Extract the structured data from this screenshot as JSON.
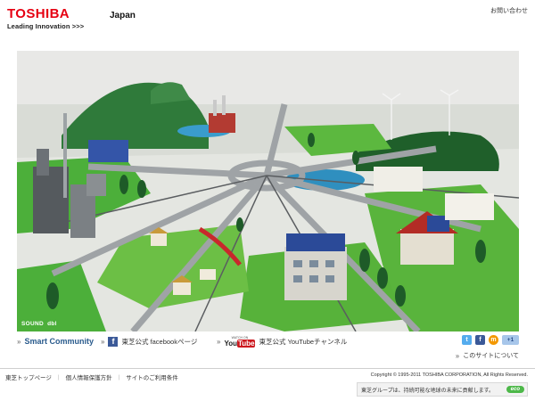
{
  "header": {
    "logo_name": "TOSHIBA",
    "logo_tagline": "Leading Innovation",
    "logo_arrows": ">>>",
    "country": "Japan",
    "contact_link": "お問い合わせ"
  },
  "stage": {
    "sound_label": "SOUND",
    "sound_indicator": "dbl"
  },
  "linkbar": {
    "smart_community": "Smart Community",
    "facebook_icon_letter": "f",
    "facebook_label": "東芝公式 facebookページ",
    "youtube_watch_on": "WATCH ON",
    "youtube_you": "You",
    "youtube_tube": "Tube",
    "youtube_label": "東芝公式 YouTubeチャンネル",
    "link_marker": "»",
    "social": {
      "twitter": "t",
      "facebook": "f",
      "mixi": "m",
      "google_plus": "+1"
    },
    "about": "このサイトについて"
  },
  "footer": {
    "nav": [
      "東芝トップページ",
      "個人情報保護方針",
      "サイトのご利用条件"
    ],
    "separator": "|",
    "copyright": "Copyright © 1995-2011 TOSHIBA CORPORATION, All Rights Reserved.",
    "eco_text": "東芝グループは、持続可能な地球の未来に貢献します。",
    "eco_badge": "eco"
  },
  "colors": {
    "brand_red": "#e60012",
    "link_blue": "#2a5b8d",
    "grass": "#4caf3a",
    "water": "#2f8fbf"
  }
}
